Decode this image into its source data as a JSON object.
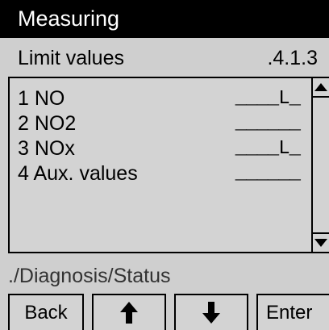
{
  "title": "Measuring",
  "subheader": {
    "label": "Limit values",
    "number": ".4.1.3"
  },
  "items": [
    {
      "label": "1 NO",
      "value": "____L_"
    },
    {
      "label": "2 NO2",
      "value": "______"
    },
    {
      "label": "3 NOx",
      "value": "____L_"
    },
    {
      "label": "4 Aux. values",
      "value": "______"
    }
  ],
  "status_path": "./Diagnosis/Status",
  "softkeys": {
    "back": "Back",
    "up": "up-arrow-icon",
    "down": "down-arrow-icon",
    "enter": "Enter"
  },
  "colors": {
    "title_bg": "#000000",
    "title_fg": "#ffffff",
    "screen_bg": "#cfcfcf"
  }
}
